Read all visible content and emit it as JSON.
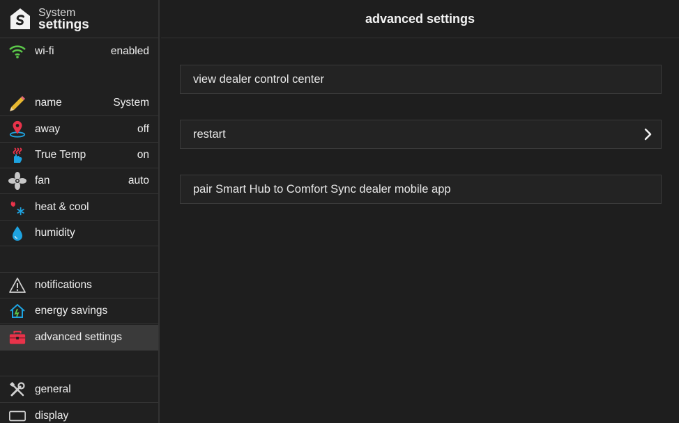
{
  "brand": {
    "top": "System",
    "bottom": "settings"
  },
  "sidebar": {
    "items": [
      {
        "label": "wi-fi",
        "value": "enabled",
        "icon": "wifi-icon"
      },
      {
        "label": "name",
        "value": "System",
        "icon": "pencil-icon"
      },
      {
        "label": "away",
        "value": "off",
        "icon": "location-pin-icon"
      },
      {
        "label": "True Temp",
        "value": "on",
        "icon": "true-temp-icon"
      },
      {
        "label": "fan",
        "value": "auto",
        "icon": "fan-icon"
      },
      {
        "label": "heat & cool",
        "value": "",
        "icon": "heat-cool-icon"
      },
      {
        "label": "humidity",
        "value": "",
        "icon": "water-drop-icon"
      },
      {
        "label": "notifications",
        "value": "",
        "icon": "warning-icon"
      },
      {
        "label": "energy savings",
        "value": "",
        "icon": "energy-home-icon"
      },
      {
        "label": "advanced settings",
        "value": "",
        "icon": "toolbox-icon",
        "active": true
      },
      {
        "label": "general",
        "value": "",
        "icon": "tools-icon"
      },
      {
        "label": "display",
        "value": "",
        "icon": "display-icon"
      }
    ]
  },
  "main": {
    "title": "advanced settings",
    "options": [
      {
        "label": "view dealer control center"
      },
      {
        "label": "restart",
        "has_chevron": true
      },
      {
        "label": "pair Smart Hub to Comfort Sync dealer mobile app"
      }
    ]
  },
  "colors": {
    "accent_green": "#5cc84a",
    "accent_red": "#e8334a",
    "accent_blue": "#1ea3e0",
    "active_bg": "#3a3a3a"
  }
}
